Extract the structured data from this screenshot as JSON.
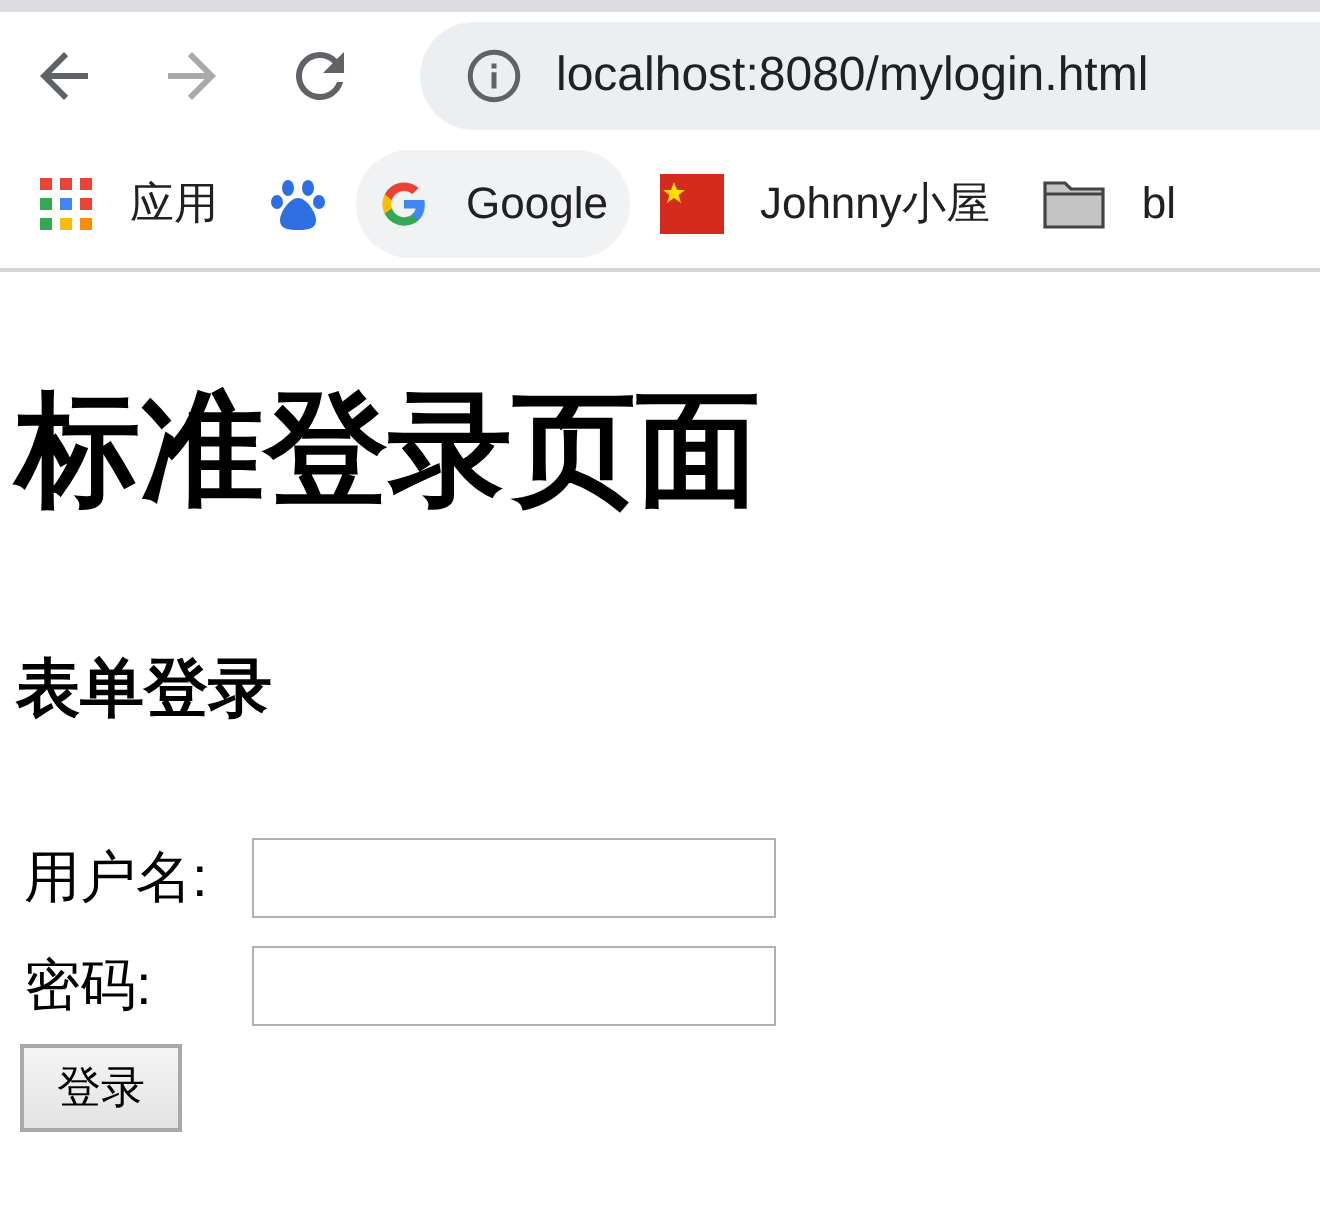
{
  "browser": {
    "url": "localhost:8080/mylogin.html",
    "forward_disabled": true
  },
  "bookmarks": [
    {
      "kind": "apps",
      "label": "应用"
    },
    {
      "kind": "paw"
    },
    {
      "kind": "google",
      "label": "Google",
      "selected": true
    },
    {
      "kind": "flag",
      "label": "Johnny小屋"
    },
    {
      "kind": "folder",
      "label": "bl"
    }
  ],
  "page": {
    "title": "标准登录页面",
    "subtitle": "表单登录",
    "fields": [
      {
        "label": "用户名:"
      },
      {
        "label": "密码:"
      }
    ],
    "submit": "登录"
  }
}
